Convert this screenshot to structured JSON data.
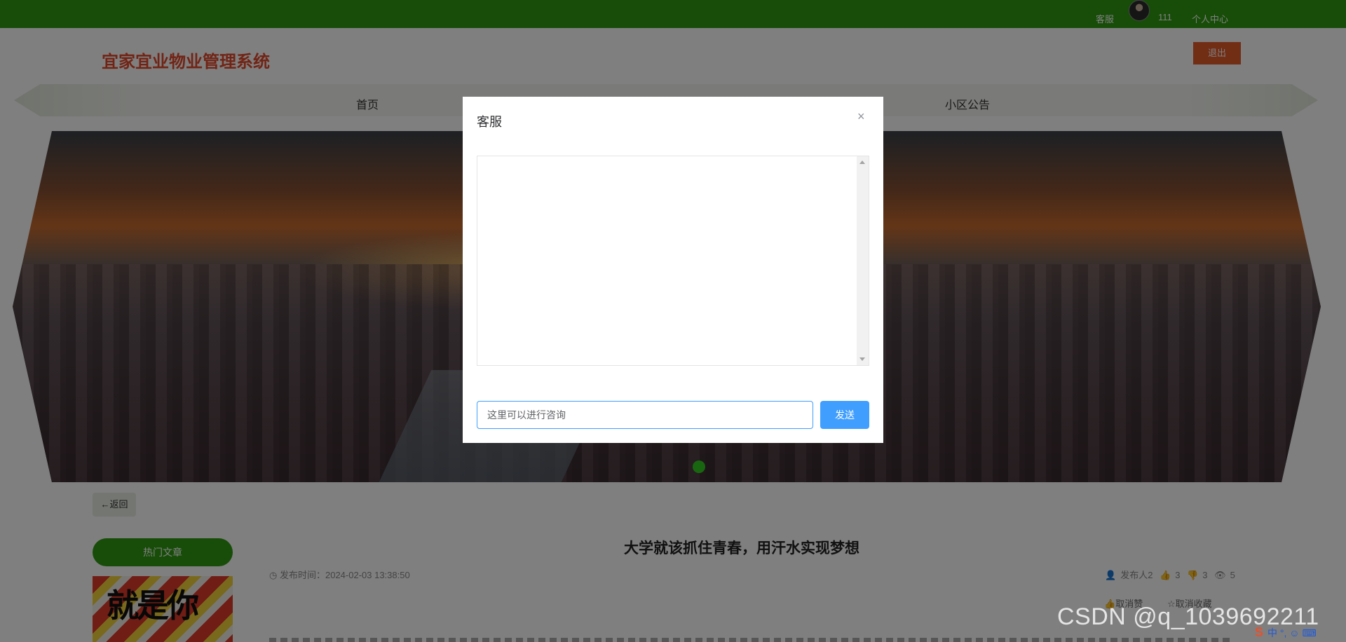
{
  "topbar": {
    "customer_service": "客服",
    "username": "111",
    "personal_center": "个人中心"
  },
  "header": {
    "site_title": "宜家宜业物业管理系统",
    "logout_label": "退出"
  },
  "nav": {
    "items": [
      "首页",
      "小区公告"
    ]
  },
  "content": {
    "back_label": "←返回",
    "hot_articles_label": "热门文章",
    "thumb_text": "就是你",
    "article_title": "大学就该抓住青春，用汗水实现梦想",
    "publish_label": "发布时间：",
    "publish_time": "2024-02-03 13:38:50",
    "author": "发布人2",
    "likes": "3",
    "dislikes": "3",
    "views": "5",
    "unlike_label": "取消赞",
    "uncollect_label": "取消收藏"
  },
  "dialog": {
    "title": "客服",
    "close_glyph": "×",
    "input_value": "这里可以进行咨询",
    "send_label": "发送"
  },
  "watermark": "CSDN @q_1039692211",
  "ime_tray": {
    "label": "中"
  },
  "colors": {
    "topbar": "#2f9a10",
    "brand_title": "#e2492b",
    "logout": "#e45a2b",
    "primary": "#409eff"
  }
}
